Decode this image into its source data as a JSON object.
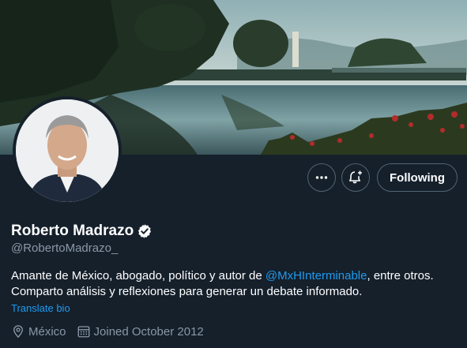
{
  "profile": {
    "display_name": "Roberto Madrazo",
    "handle": "@RobertoMadrazo_",
    "verified_icon": "verified-badge-icon",
    "bio_part1": "Amante de México, abogado, político y autor de ",
    "bio_mention": "@MxHInterminable",
    "bio_part2": ", entre otros. Comparto análisis y reflexiones para generar un debate informado.",
    "translate_label": "Translate bio",
    "location": "México",
    "joined": "Joined October 2012"
  },
  "actions": {
    "more_icon": "more-icon",
    "notify_icon": "bell-plus-icon",
    "following_label": "Following"
  },
  "colors": {
    "background": "#15202b",
    "link": "#1d9bf0",
    "secondary_text": "#8b98a5",
    "border": "#536471"
  }
}
